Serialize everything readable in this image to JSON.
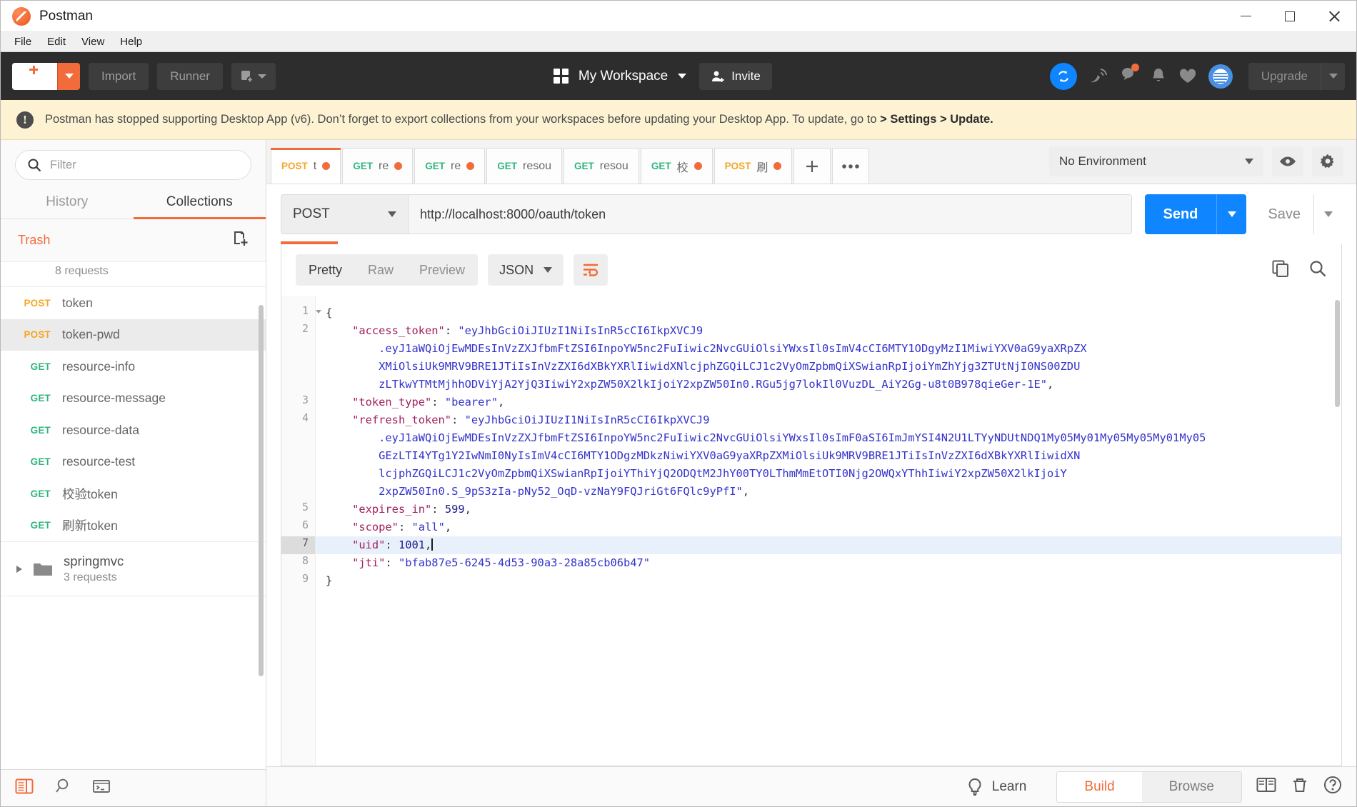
{
  "window": {
    "title": "Postman",
    "minimize": "minimize-button",
    "maximize": "maximize-button",
    "close": "close-button"
  },
  "menubar": {
    "items": [
      "File",
      "Edit",
      "View",
      "Help"
    ]
  },
  "topbar": {
    "new_label": "New",
    "import_label": "Import",
    "runner_label": "Runner",
    "workspace_name": "My Workspace",
    "invite_label": "Invite",
    "upgrade_label": "Upgrade",
    "icons": [
      "sync-icon",
      "satellite-icon",
      "comment-icon",
      "bell-icon",
      "heart-icon",
      "avatar-icon"
    ]
  },
  "banner": {
    "text_before": "Postman has stopped supporting Desktop App (v6). Don’t forget to export collections from your workspaces before updating your Desktop App. To update, go to ",
    "text_bold": " > Settings > Update."
  },
  "sidebar": {
    "filter_placeholder": "Filter",
    "filter_value": "",
    "tabs": [
      {
        "label": "History",
        "active": false
      },
      {
        "label": "Collections",
        "active": true
      }
    ],
    "trash_label": "Trash",
    "collection_count": "8 requests",
    "requests": [
      {
        "method": "POST",
        "name": "token",
        "selected": false
      },
      {
        "method": "POST",
        "name": "token-pwd",
        "selected": true
      },
      {
        "method": "GET",
        "name": "resource-info",
        "selected": false
      },
      {
        "method": "GET",
        "name": "resource-message",
        "selected": false
      },
      {
        "method": "GET",
        "name": "resource-data",
        "selected": false
      },
      {
        "method": "GET",
        "name": "resource-test",
        "selected": false
      },
      {
        "method": "GET",
        "name": "校验token",
        "selected": false
      },
      {
        "method": "GET",
        "name": "刷新token",
        "selected": false
      }
    ],
    "folder": {
      "name": "springmvc",
      "count": "3 requests"
    },
    "bottom_icons": [
      "sidebar-toggle-icon",
      "search-icon",
      "console-icon"
    ]
  },
  "tabs": [
    {
      "method": "POST",
      "name": "t",
      "unsaved": true,
      "active": true
    },
    {
      "method": "GET",
      "name": "re",
      "unsaved": true,
      "active": false
    },
    {
      "method": "GET",
      "name": "re",
      "unsaved": true,
      "active": false
    },
    {
      "method": "GET",
      "name": "resou",
      "unsaved": false,
      "active": false
    },
    {
      "method": "GET",
      "name": "resou",
      "unsaved": false,
      "active": false
    },
    {
      "method": "GET",
      "name": "校",
      "unsaved": true,
      "active": false
    },
    {
      "method": "POST",
      "name": "刷",
      "unsaved": true,
      "active": false
    }
  ],
  "environment": {
    "selected": "No Environment",
    "eye_icon": "eye-icon",
    "gear_icon": "gear-icon"
  },
  "request": {
    "method": "POST",
    "url": "http://localhost:8000/oauth/token",
    "send_label": "Send",
    "save_label": "Save"
  },
  "response": {
    "view_modes": [
      {
        "label": "Pretty",
        "active": true
      },
      {
        "label": "Raw",
        "active": false
      },
      {
        "label": "Preview",
        "active": false
      }
    ],
    "format": "JSON",
    "wrap_icon": "word-wrap-icon",
    "copy_icon": "copy-icon",
    "search_icon": "search-icon",
    "lines": [
      {
        "num": "1",
        "fold": true,
        "hl": false,
        "html": "<span class=\"p\">{</span>"
      },
      {
        "num": "2",
        "fold": false,
        "hl": false,
        "html": "    <span class=\"k\">\"access_token\"</span><span class=\"p\">: </span><span class=\"s\">\"eyJhbGciOiJIUzI1NiIsInR5cCI6IkpXVCJ9</span>"
      },
      {
        "num": "",
        "fold": false,
        "hl": false,
        "html": "        <span class=\"s\">.eyJ1aWQiOjEwMDEsInVzZXJfbmFtZSI6InpoYW5nc2FuIiwic2NvcGUiOlsiYWxsIl0sImV4cCI6MTY1ODgyMzI1MiwiYXV0aG9yaXRpZX</span>"
      },
      {
        "num": "",
        "fold": false,
        "hl": false,
        "html": "        <span class=\"s\">XMiOlsiUk9MRV9BRE1JTiIsInVzZXI6dXBkYXRlIiwidXNlcjphZGQiLCJ1c2VyOmZpbmQiXSwianRpIjoiYmZhYjg3ZTUtNjI0NS00ZDU</span>"
      },
      {
        "num": "",
        "fold": false,
        "hl": false,
        "html": "        <span class=\"s\">zLTkwYTMtMjhhODViYjA2YjQ3IiwiY2xpZW50X2lkIjoiY2xpZW50In0.RGu5jg7lokIl0VuzDL_AiY2Gg-u8t0B978qieGer-1E\"</span><span class=\"p\">,</span>"
      },
      {
        "num": "3",
        "fold": false,
        "hl": false,
        "html": "    <span class=\"k\">\"token_type\"</span><span class=\"p\">: </span><span class=\"s\">\"bearer\"</span><span class=\"p\">,</span>"
      },
      {
        "num": "4",
        "fold": false,
        "hl": false,
        "html": "    <span class=\"k\">\"refresh_token\"</span><span class=\"p\">: </span><span class=\"s\">\"eyJhbGciOiJIUzI1NiIsInR5cCI6IkpXVCJ9</span>"
      },
      {
        "num": "",
        "fold": false,
        "hl": false,
        "html": "        <span class=\"s\">.eyJ1aWQiOjEwMDEsInVzZXJfbmFtZSI6InpoYW5nc2FuIiwic2NvcGUiOlsiYWxsIl0sImF0aSI6ImJmYSI4N2U1LTYyNDUtNDQ1My05My01My05My05My01My05</span>"
      },
      {
        "num": "",
        "fold": false,
        "hl": false,
        "html": "        <span class=\"s\">GEzLTI4YTg1Y2IwNmI0NyIsImV4cCI6MTY1ODgzMDkzNiwiYXV0aG9yaXRpZXMiOlsiUk9MRV9BRE1JTiIsInVzZXI6dXBkYXRlIiwidXN</span>"
      },
      {
        "num": "",
        "fold": false,
        "hl": false,
        "html": "        <span class=\"s\">lcjphZGQiLCJ1c2VyOmZpbmQiXSwianRpIjoiYThiYjQ2ODQtM2JhY00TY0LThmMmEtOTI0Njg2OWQxYThhIiwiY2xpZW50X2lkIjoiY</span>"
      },
      {
        "num": "",
        "fold": false,
        "hl": false,
        "html": "        <span class=\"s\">2xpZW50In0.S_9pS3zIa-pNy52_OqD-vzNaY9FQJriGt6FQlc9yPfI\"</span><span class=\"p\">,</span>"
      },
      {
        "num": "5",
        "fold": false,
        "hl": false,
        "html": "    <span class=\"k\">\"expires_in\"</span><span class=\"p\">: </span><span class=\"n\">599</span><span class=\"p\">,</span>"
      },
      {
        "num": "6",
        "fold": false,
        "hl": false,
        "html": "    <span class=\"k\">\"scope\"</span><span class=\"p\">: </span><span class=\"s\">\"all\"</span><span class=\"p\">,</span>"
      },
      {
        "num": "7",
        "fold": false,
        "hl": true,
        "html": "    <span class=\"k\">\"uid\"</span><span class=\"p\">: </span><span class=\"n\">1001</span><span class=\"p\">,</span><span class=\"caret-bar\"></span>"
      },
      {
        "num": "8",
        "fold": false,
        "hl": false,
        "html": "    <span class=\"k\">\"jti\"</span><span class=\"p\">: </span><span class=\"s\">\"bfab87e5-6245-4d53-90a3-28a85cb06b47\"</span>"
      },
      {
        "num": "9",
        "fold": false,
        "hl": false,
        "html": "<span class=\"p\">}</span>"
      }
    ]
  },
  "footer": {
    "learn_label": "Learn",
    "modes": [
      {
        "label": "Build",
        "active": true
      },
      {
        "label": "Browse",
        "active": false
      }
    ],
    "icons": [
      "two-pane-icon",
      "trash-icon",
      "help-icon"
    ]
  },
  "colors": {
    "accent": "#f26b3a",
    "send": "#0f85ff",
    "post": "#f5a623",
    "get": "#2eb67d",
    "banner_bg": "#fdf3d3",
    "header_bg": "#2d2d2d"
  }
}
